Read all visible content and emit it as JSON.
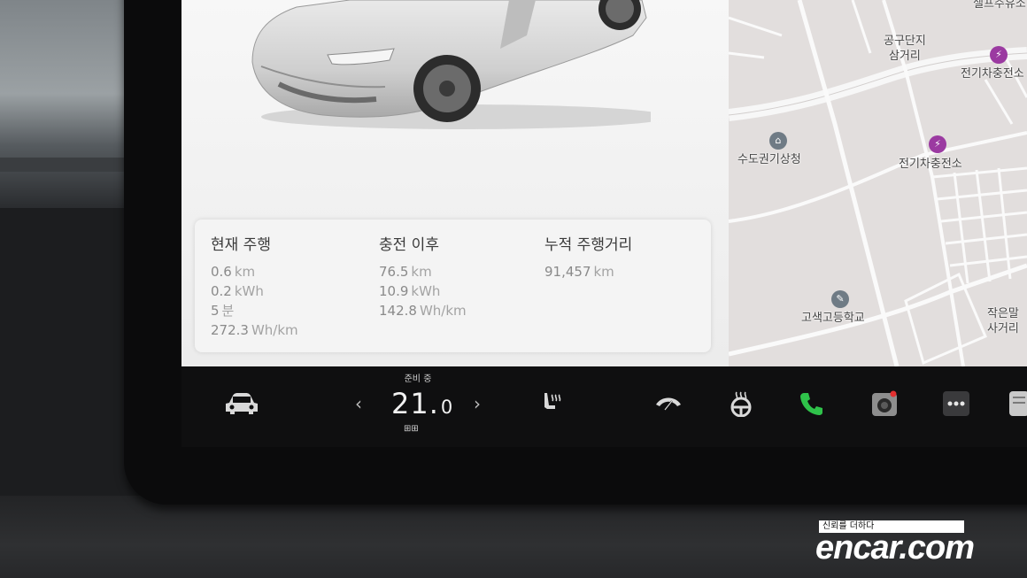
{
  "trip_panel": {
    "current": {
      "title": "현재 주행",
      "rows": [
        {
          "value": "0.6",
          "unit": "km"
        },
        {
          "value": "0.2",
          "unit": "kWh"
        },
        {
          "value": "5",
          "unit": "분"
        },
        {
          "value": "272.3",
          "unit": "Wh/km"
        }
      ]
    },
    "since_charge": {
      "title": "충전 이후",
      "rows": [
        {
          "value": "76.5",
          "unit": "km"
        },
        {
          "value": "10.9",
          "unit": "kWh"
        },
        {
          "value": "142.8",
          "unit": "Wh/km"
        }
      ]
    },
    "odometer": {
      "title": "누적 주행거리",
      "rows": [
        {
          "value": "91,457",
          "unit": "km"
        }
      ]
    }
  },
  "map": {
    "labels": {
      "top_right_partial": "셀프주유소",
      "gonggudanji_line1": "공구단지",
      "gonggudanji_line2": "삼거리",
      "ev_station_1": "전기차충전소",
      "metropolitan_office": "수도권기상청",
      "ev_station_2": "전기차충전소",
      "goseak_high_school": "고색고등학교",
      "jageunmal_line1": "작은말",
      "jageunmal_line2": "사거리"
    }
  },
  "bottom_bar": {
    "climate_status": "준비 중",
    "temperature_whole": "21.",
    "temperature_decimal": "0",
    "left_chevron": "‹",
    "right_chevron": "›",
    "defrost_glyphs": "⊞⊞",
    "colors": {
      "phone_green": "#2fc24a",
      "camera_red_dot": "#e23030"
    }
  },
  "watermark": {
    "tagline": "신뢰를 더하다",
    "logo": "encar.com"
  }
}
